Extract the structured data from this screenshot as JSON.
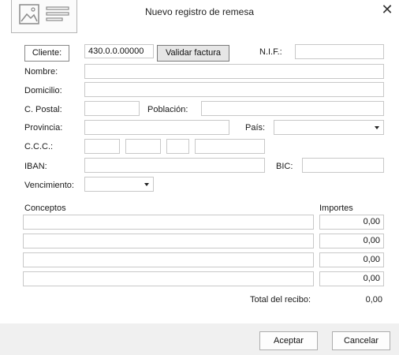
{
  "window": {
    "title": "Nuevo registro de remesa",
    "close_icon": "close-icon"
  },
  "header": {
    "icon": "image-document-icon"
  },
  "cliente": {
    "button_label": "Cliente:",
    "value": "430.0.0.00000",
    "validar_label": "Validar factura"
  },
  "nif": {
    "label": "N.I.F.:",
    "value": ""
  },
  "nombre": {
    "label": "Nombre:",
    "value": ""
  },
  "domicilio": {
    "label": "Domicilio:",
    "value": ""
  },
  "cpostal": {
    "label": "C. Postal:",
    "value": ""
  },
  "poblacion": {
    "label": "Población:",
    "value": ""
  },
  "provincia": {
    "label": "Provincia:",
    "value": ""
  },
  "pais": {
    "label": "País:",
    "value": ""
  },
  "ccc": {
    "label": "C.C.C.:",
    "values": [
      "",
      "",
      "",
      ""
    ]
  },
  "iban": {
    "label": "IBAN:",
    "value": ""
  },
  "bic": {
    "label": "BIC:",
    "value": ""
  },
  "vencimiento": {
    "label": "Vencimiento:",
    "value": ""
  },
  "lines": {
    "conceptos_header": "Conceptos",
    "importes_header": "Importes",
    "rows": [
      {
        "concepto": "",
        "importe": "0,00"
      },
      {
        "concepto": "",
        "importe": "0,00"
      },
      {
        "concepto": "",
        "importe": "0,00"
      },
      {
        "concepto": "",
        "importe": "0,00"
      }
    ]
  },
  "total": {
    "label": "Total del recibo:",
    "value": "0,00"
  },
  "footer": {
    "accept_label": "Aceptar",
    "cancel_label": "Cancelar"
  }
}
